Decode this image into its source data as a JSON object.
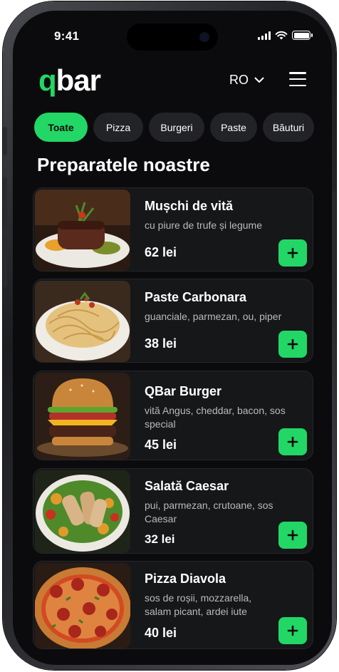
{
  "status_bar": {
    "time": "9:41"
  },
  "header": {
    "logo_accent": "q",
    "logo_rest": "bar",
    "language": "RO"
  },
  "categories": [
    {
      "label": "Toate",
      "active": true
    },
    {
      "label": "Pizza",
      "active": false
    },
    {
      "label": "Burgeri",
      "active": false
    },
    {
      "label": "Paste",
      "active": false
    },
    {
      "label": "Băuturi",
      "active": false
    }
  ],
  "section_title": "Preparatele noastre",
  "menu_items": [
    {
      "name": "Mușchi de vită",
      "description": "cu piure de trufe și legume",
      "price": "62 lei",
      "image": "steak-photo"
    },
    {
      "name": "Paste Carbonara",
      "description": "guanciale, parmezan, ou, piper",
      "price": "38 lei",
      "image": "carbonara-photo"
    },
    {
      "name": "QBar Burger",
      "description": "vită Angus, cheddar, bacon, sos special",
      "price": "45 lei",
      "image": "burger-photo"
    },
    {
      "name": "Salată Caesar",
      "description": "pui, parmezan, crutoane, sos Caesar",
      "price": "32 lei",
      "image": "caesar-salad-photo"
    },
    {
      "name": "Pizza Diavola",
      "description": "sos de roșii, mozzarella, salam picant, ardei iute",
      "price": "40 lei",
      "image": "pizza-photo"
    }
  ],
  "colors": {
    "accent": "#22d765",
    "background": "#0b0b0d",
    "card": "#161719",
    "chip": "#222327",
    "text_muted": "#b8babd"
  }
}
